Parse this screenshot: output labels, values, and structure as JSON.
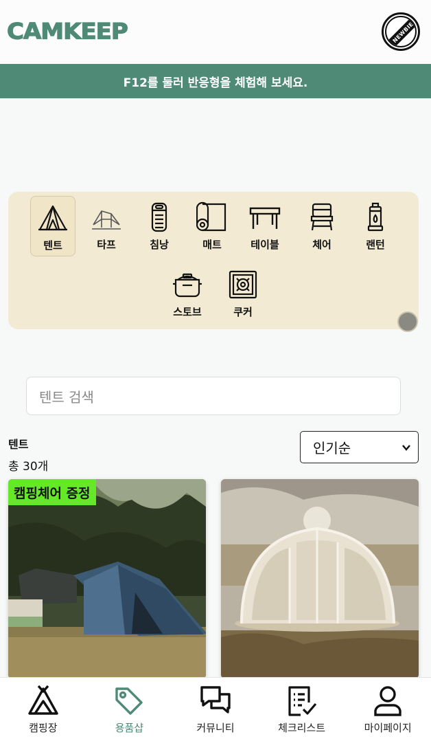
{
  "header": {
    "logo": "CAMKEEP",
    "badge": "NEWBIE",
    "badge_icon": "newbie-badge-icon"
  },
  "banner": {
    "text": "F12를 둘러 반응형을 체험해 보세요."
  },
  "categories": [
    {
      "label": "텐트",
      "icon": "tent-icon",
      "active": true
    },
    {
      "label": "타프",
      "icon": "tarp-icon"
    },
    {
      "label": "침낭",
      "icon": "sleeping-bag-icon"
    },
    {
      "label": "매트",
      "icon": "mat-icon"
    },
    {
      "label": "테이블",
      "icon": "table-icon"
    },
    {
      "label": "체어",
      "icon": "chair-icon"
    },
    {
      "label": "랜턴",
      "icon": "lantern-icon"
    },
    {
      "label": "스토브",
      "icon": "stove-icon"
    },
    {
      "label": "쿠커",
      "icon": "cooker-icon"
    }
  ],
  "search": {
    "placeholder": "텐트 검색"
  },
  "result": {
    "category": "텐트",
    "count": "총 30개"
  },
  "sort": {
    "selected": "인기순"
  },
  "products": [
    {
      "badge": "캠핑체어 증정",
      "image": "blue-tent-campsite-photo"
    },
    {
      "image": "dome-screen-tent-photo"
    }
  ],
  "bottom_nav": [
    {
      "label": "캠핑장",
      "icon": "tent-icon"
    },
    {
      "label": "용품샵",
      "icon": "tag-icon",
      "active": true
    },
    {
      "label": "커뮤니티",
      "icon": "chat-icon"
    },
    {
      "label": "체크리스트",
      "icon": "checklist-icon"
    },
    {
      "label": "마이페이지",
      "icon": "user-icon"
    }
  ],
  "colors": {
    "accent": "#4e8a75",
    "category_bg": "#f3ead3",
    "promo": "#64e827"
  }
}
